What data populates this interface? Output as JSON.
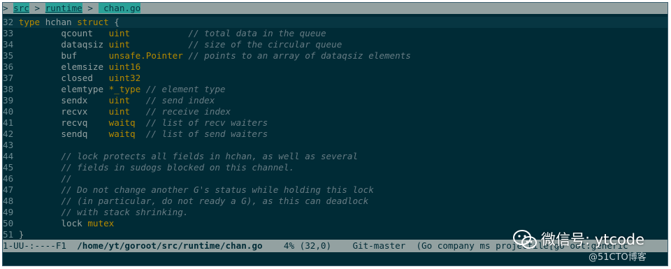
{
  "header": {
    "prefix": "> ",
    "crumbs": [
      "src",
      "runtime"
    ],
    "separator": " > ",
    "file": " chan.go"
  },
  "code": {
    "lines": [
      {
        "n": "32",
        "segs": [
          {
            "c": "kw",
            "t": "type"
          },
          {
            "c": "id",
            "t": " hchan "
          },
          {
            "c": "kw",
            "t": "struct"
          },
          {
            "c": "id",
            "t": " {"
          }
        ]
      },
      {
        "n": "33",
        "segs": [
          {
            "c": "id",
            "t": "        qcount   "
          },
          {
            "c": "ty",
            "t": "uint"
          },
          {
            "c": "id",
            "t": "           "
          },
          {
            "c": "cm",
            "t": "// total data in the queue"
          }
        ]
      },
      {
        "n": "34",
        "segs": [
          {
            "c": "id",
            "t": "        dataqsiz "
          },
          {
            "c": "ty",
            "t": "uint"
          },
          {
            "c": "id",
            "t": "           "
          },
          {
            "c": "cm",
            "t": "// size of the circular queue"
          }
        ]
      },
      {
        "n": "35",
        "segs": [
          {
            "c": "id",
            "t": "        buf      "
          },
          {
            "c": "ty",
            "t": "unsafe.Pointer"
          },
          {
            "c": "id",
            "t": " "
          },
          {
            "c": "cm",
            "t": "// points to an array of dataqsiz elements"
          }
        ]
      },
      {
        "n": "36",
        "segs": [
          {
            "c": "id",
            "t": "        elemsize "
          },
          {
            "c": "ty",
            "t": "uint16"
          }
        ]
      },
      {
        "n": "37",
        "segs": [
          {
            "c": "id",
            "t": "        closed   "
          },
          {
            "c": "ty",
            "t": "uint32"
          }
        ]
      },
      {
        "n": "38",
        "segs": [
          {
            "c": "id",
            "t": "        elemtype "
          },
          {
            "c": "ty",
            "t": "*_type"
          },
          {
            "c": "id",
            "t": " "
          },
          {
            "c": "cm",
            "t": "// element type"
          }
        ]
      },
      {
        "n": "39",
        "segs": [
          {
            "c": "id",
            "t": "        sendx    "
          },
          {
            "c": "ty",
            "t": "uint"
          },
          {
            "c": "id",
            "t": "   "
          },
          {
            "c": "cm",
            "t": "// send index"
          }
        ]
      },
      {
        "n": "40",
        "segs": [
          {
            "c": "id",
            "t": "        recvx    "
          },
          {
            "c": "ty",
            "t": "uint"
          },
          {
            "c": "id",
            "t": "   "
          },
          {
            "c": "cm",
            "t": "// receive index"
          }
        ]
      },
      {
        "n": "41",
        "segs": [
          {
            "c": "id",
            "t": "        recvq    "
          },
          {
            "c": "ty",
            "t": "waitq"
          },
          {
            "c": "id",
            "t": "  "
          },
          {
            "c": "cm",
            "t": "// list of recv waiters"
          }
        ]
      },
      {
        "n": "42",
        "segs": [
          {
            "c": "id",
            "t": "        sendq    "
          },
          {
            "c": "ty",
            "t": "waitq"
          },
          {
            "c": "id",
            "t": "  "
          },
          {
            "c": "cm",
            "t": "// list of send waiters"
          }
        ]
      },
      {
        "n": "43",
        "segs": []
      },
      {
        "n": "44",
        "segs": [
          {
            "c": "id",
            "t": "        "
          },
          {
            "c": "cm",
            "t": "// lock protects all fields in hchan, as well as several"
          }
        ]
      },
      {
        "n": "45",
        "segs": [
          {
            "c": "id",
            "t": "        "
          },
          {
            "c": "cm",
            "t": "// fields in sudogs blocked on this channel."
          }
        ]
      },
      {
        "n": "46",
        "segs": [
          {
            "c": "id",
            "t": "        "
          },
          {
            "c": "cm",
            "t": "//"
          }
        ]
      },
      {
        "n": "47",
        "segs": [
          {
            "c": "id",
            "t": "        "
          },
          {
            "c": "cm",
            "t": "// Do not change another G's status while holding this lock"
          }
        ]
      },
      {
        "n": "48",
        "segs": [
          {
            "c": "id",
            "t": "        "
          },
          {
            "c": "cm",
            "t": "// (in particular, do not ready a G), as this can deadlock"
          }
        ]
      },
      {
        "n": "49",
        "segs": [
          {
            "c": "id",
            "t": "        "
          },
          {
            "c": "cm",
            "t": "// with stack shrinking."
          }
        ]
      },
      {
        "n": "50",
        "segs": [
          {
            "c": "id",
            "t": "        lock "
          },
          {
            "c": "ty",
            "t": "mutex"
          }
        ]
      },
      {
        "n": "51",
        "segs": [
          {
            "c": "id",
            "t": "}"
          }
        ]
      }
    ]
  },
  "modeline": {
    "status": "1-UU-:----F1  ",
    "path": "/home/yt/goroot/src/runtime/chan.go",
    "position": "    4% (32,0)    ",
    "vc": "Git-master  ",
    "modes": "(Go company ms projectile[go oot:generic"
  },
  "watermark": {
    "text": "微信号: ytcode",
    "site": "@51CTO博客"
  },
  "colors": {
    "background": "#002b36",
    "current_line": "#073642",
    "keyword": "#b58900",
    "comment": "#657b83",
    "modeline": "#93a1a1",
    "breadcrumb": "#2aa198"
  }
}
